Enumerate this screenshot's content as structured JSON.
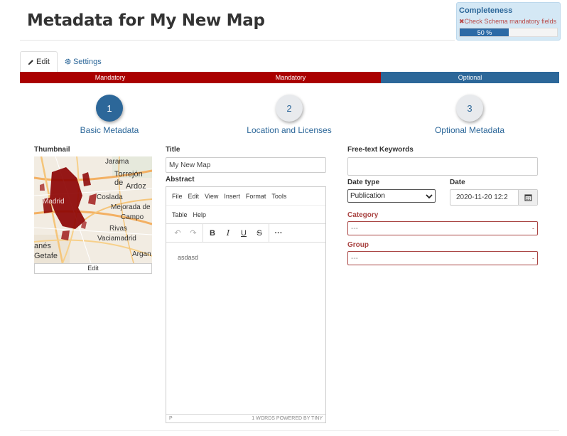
{
  "page": {
    "title": "Metadata for My New Map"
  },
  "completeness": {
    "title": "Completeness",
    "warning": "Check Schema mandatory fields",
    "percent_label": "50 %",
    "percent": 50
  },
  "tabs": [
    {
      "label": "Edit",
      "icon": "pencil-icon",
      "active": true
    },
    {
      "label": "Settings",
      "icon": "gear-icon",
      "active": false
    }
  ],
  "progress": [
    "Mandatory",
    "Mandatory",
    "Optional"
  ],
  "steps": [
    {
      "number": "1",
      "label": "Basic Metadata",
      "active": true
    },
    {
      "number": "2",
      "label": "Location and Licenses",
      "active": false
    },
    {
      "number": "3",
      "label": "Optional Metadata",
      "active": false
    }
  ],
  "thumbnail": {
    "label": "Thumbnail",
    "edit_label": "Edit",
    "places": [
      "Jarama",
      "Torrejón de",
      "Ardoz",
      "Coslada",
      "Mejorada de",
      "Campo",
      "Rivas",
      "Vaciamadrid",
      "Madrid",
      "Getafe",
      "anés",
      "Argan"
    ]
  },
  "title_field": {
    "label": "Title",
    "value": "My New Map"
  },
  "abstract": {
    "label": "Abstract",
    "menu_row1": [
      "File",
      "Edit",
      "View",
      "Insert",
      "Format",
      "Tools"
    ],
    "menu_row2": [
      "Table",
      "Help"
    ],
    "content": "asdasd",
    "status_left": "P",
    "status_right": "1 WORDS  POWERED BY TINY"
  },
  "keywords": {
    "label": "Free-text Keywords",
    "value": ""
  },
  "date_type": {
    "label": "Date type",
    "value": "Publication"
  },
  "date": {
    "label": "Date",
    "value": "2020-11-20 12:2"
  },
  "category": {
    "label": "Category",
    "value": "---"
  },
  "group": {
    "label": "Group",
    "value": "---"
  },
  "colors": {
    "mandatory": "#aa0000",
    "optional": "#2c6799",
    "accent": "#2c6799",
    "error": "#a94442"
  }
}
